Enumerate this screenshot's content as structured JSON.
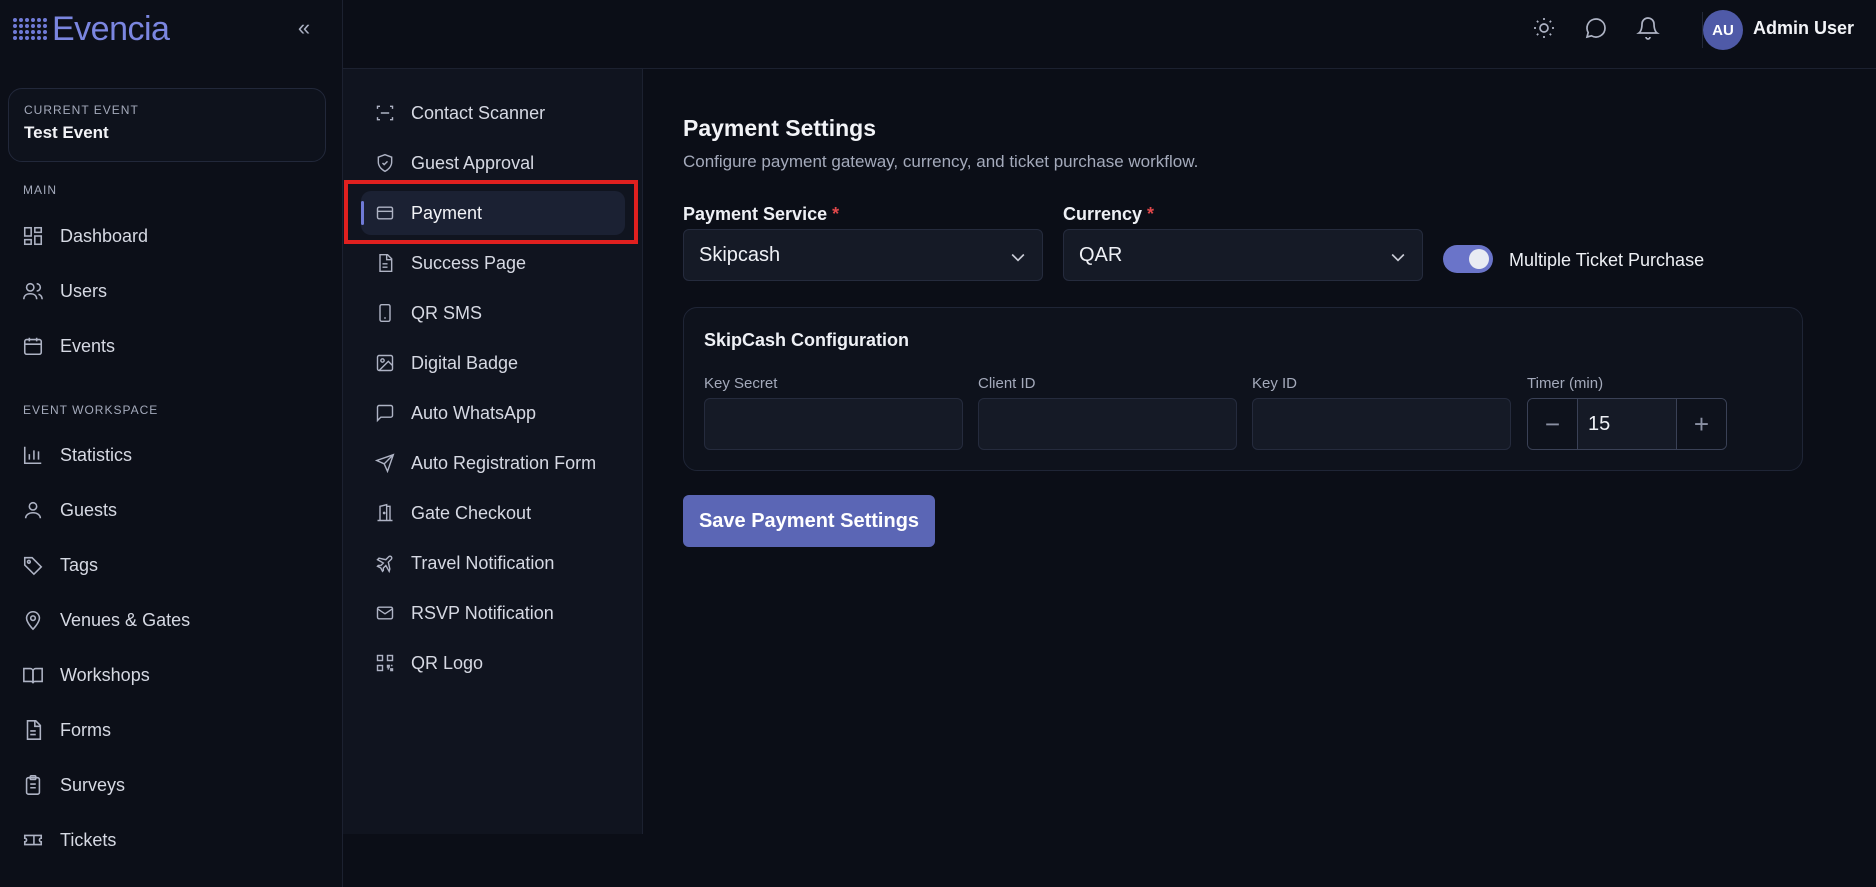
{
  "app": {
    "name": "Evencia",
    "collapse_glyph": "«"
  },
  "current_event": {
    "label": "CURRENT EVENT",
    "name": "Test Event"
  },
  "sidebar": {
    "main_label": "MAIN",
    "main_items": [
      {
        "label": "Dashboard",
        "icon": "dashboard-icon"
      },
      {
        "label": "Users",
        "icon": "users-icon"
      },
      {
        "label": "Events",
        "icon": "calendar-icon"
      }
    ],
    "workspace_label": "EVENT WORKSPACE",
    "workspace_items": [
      {
        "label": "Statistics",
        "icon": "bar-chart-icon"
      },
      {
        "label": "Guests",
        "icon": "user-icon"
      },
      {
        "label": "Tags",
        "icon": "tag-icon"
      },
      {
        "label": "Venues & Gates",
        "icon": "map-pin-icon"
      },
      {
        "label": "Workshops",
        "icon": "book-icon"
      },
      {
        "label": "Forms",
        "icon": "file-icon"
      },
      {
        "label": "Surveys",
        "icon": "clipboard-icon"
      },
      {
        "label": "Tickets",
        "icon": "ticket-icon"
      }
    ]
  },
  "topbar": {
    "user_initials": "AU",
    "user_name": "Admin User"
  },
  "subnav": {
    "items": [
      {
        "label": "Contact Scanner",
        "icon": "scan-icon"
      },
      {
        "label": "Guest Approval",
        "icon": "shield-check-icon"
      },
      {
        "label": "Payment",
        "icon": "credit-card-icon",
        "active": true
      },
      {
        "label": "Success Page",
        "icon": "file-text-icon"
      },
      {
        "label": "QR SMS",
        "icon": "smartphone-icon"
      },
      {
        "label": "Digital Badge",
        "icon": "image-icon"
      },
      {
        "label": "Auto WhatsApp",
        "icon": "message-square-icon"
      },
      {
        "label": "Auto Registration Form",
        "icon": "send-icon"
      },
      {
        "label": "Gate Checkout",
        "icon": "door-icon"
      },
      {
        "label": "Travel Notification",
        "icon": "plane-icon"
      },
      {
        "label": "RSVP Notification",
        "icon": "mail-icon"
      },
      {
        "label": "QR Logo",
        "icon": "qr-code-icon"
      }
    ]
  },
  "main": {
    "title": "Payment Settings",
    "subtitle": "Configure payment gateway, currency, and ticket purchase workflow.",
    "payment_service": {
      "label": "Payment Service",
      "required": "*",
      "value": "Skipcash"
    },
    "currency": {
      "label": "Currency",
      "required": "*",
      "value": "QAR"
    },
    "multiple_ticket": {
      "label": "Multiple Ticket Purchase",
      "enabled": true
    },
    "config": {
      "title": "SkipCash Configuration",
      "key_secret_label": "Key Secret",
      "key_secret_value": "",
      "client_id_label": "Client ID",
      "client_id_value": "",
      "key_id_label": "Key ID",
      "key_id_value": "",
      "timer_label": "Timer (min)",
      "timer_value": "15",
      "minus": "−",
      "plus": "+"
    },
    "save_label": "Save Payment Settings"
  },
  "colors": {
    "accent": "#5b66b5",
    "highlight": "#e0201f",
    "required": "#e0474a"
  }
}
